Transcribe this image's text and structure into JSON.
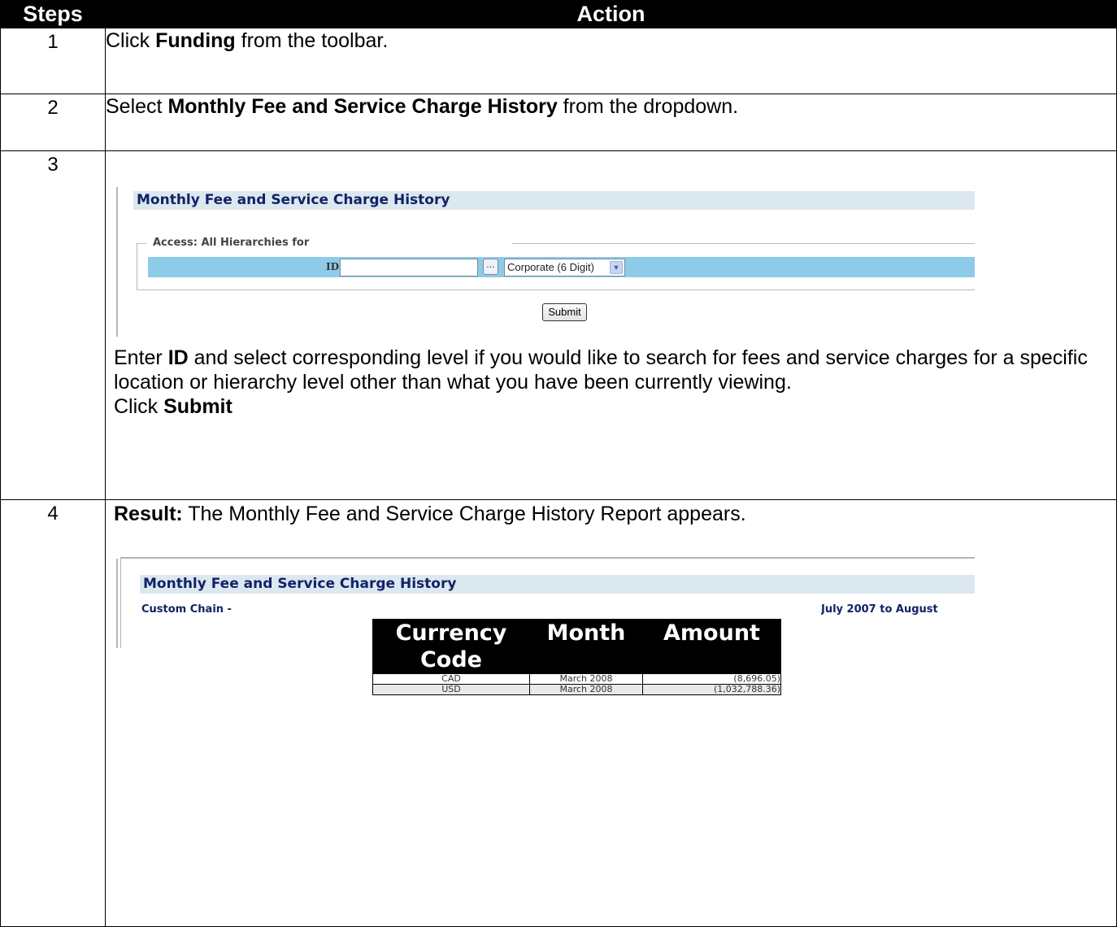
{
  "header": {
    "steps": "Steps",
    "action": "Action"
  },
  "steps": [
    {
      "num": "1",
      "pre": "Click ",
      "bold": "Funding",
      "post": " from the toolbar."
    },
    {
      "num": "2",
      "pre": "Select ",
      "bold": "Monthly Fee and Service Charge History",
      "post": " from the dropdown."
    },
    {
      "num": "3",
      "p1_pre": "Enter ",
      "p1_bold": "ID",
      "p1_post": " and select corresponding level if you would like to search for fees and service charges for a specific location or hierarchy level other than what you have been currently viewing.",
      "p2_pre": "Click ",
      "p2_bold": "Submit"
    },
    {
      "num": "4",
      "bold": "Result:",
      "post": " The Monthly Fee and Service Charge History Report appears."
    }
  ],
  "screen1": {
    "title": "Monthly Fee and Service Charge History",
    "legend": "Access: All Hierarchies for",
    "id_label": "ID",
    "id_value": "",
    "dots": "...",
    "level_select": "Corporate (6 Digit)",
    "submit": "Submit"
  },
  "screen2": {
    "title": "Monthly Fee and Service Charge History",
    "chain": "Custom Chain -",
    "date_range": "July 2007 to August",
    "columns": [
      "Currency Code",
      "Month",
      "Amount"
    ],
    "rows": [
      {
        "currency": "CAD",
        "month": "March 2008",
        "amount": "(8,696.05)"
      },
      {
        "currency": "USD",
        "month": "March 2008",
        "amount": "(1,032,788.36)"
      }
    ]
  },
  "colors": {
    "negative": "#d62020",
    "title_navy": "#122266",
    "id_bar": "#8ecbe8"
  }
}
